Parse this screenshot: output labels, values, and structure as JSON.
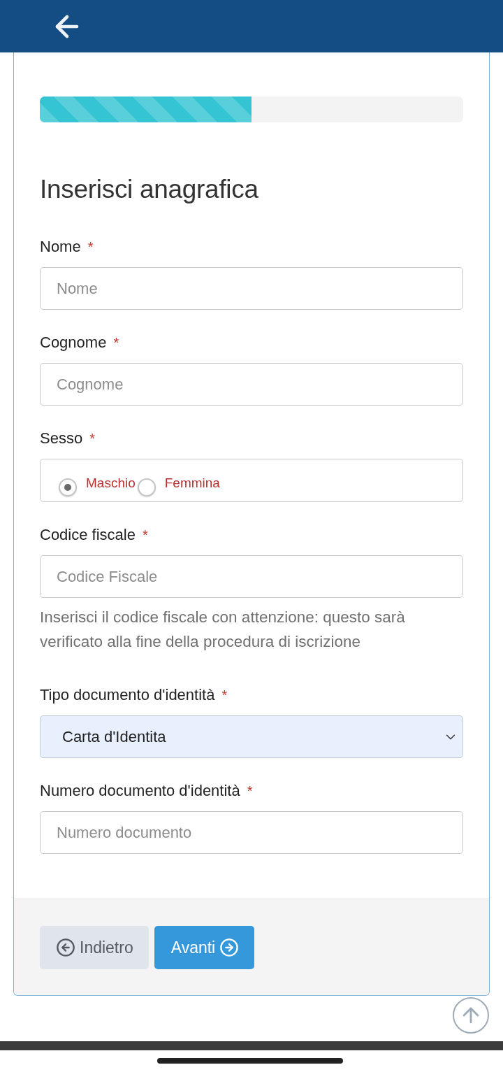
{
  "progress": {
    "level": 0.5
  },
  "title": "Inserisci anagrafica",
  "fields": [
    {
      "kind": "text",
      "label": "Nome",
      "required_mark": "*",
      "placeholder": "Nome"
    },
    {
      "kind": "text",
      "label": "Cognome",
      "required_mark": "*",
      "placeholder": "Cognome"
    },
    {
      "kind": "radio",
      "label": "Sesso",
      "required_mark": "*",
      "options": [
        {
          "label": "Maschio",
          "selected": true
        },
        {
          "label": "Femmina",
          "selected": false
        }
      ]
    },
    {
      "kind": "text",
      "label": "Codice fiscale",
      "required_mark": "*",
      "placeholder": "Codice Fiscale",
      "help": "Inserisci il codice fiscale con attenzione: questo sarà verificato alla fine della procedura di iscrizione"
    },
    {
      "kind": "select",
      "label": "Tipo documento d'identità",
      "required_mark": "*",
      "value": "Carta d'Identita"
    },
    {
      "kind": "text",
      "label": "Numero documento d'identità",
      "required_mark": "*",
      "placeholder": "Numero documento"
    }
  ],
  "buttons": [
    {
      "kind": "back",
      "label": "Indietro"
    },
    {
      "kind": "next",
      "label": "Avanti"
    }
  ]
}
